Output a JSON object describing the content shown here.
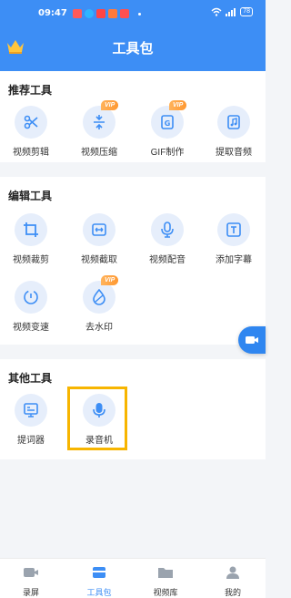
{
  "status_bar": {
    "time": "09:47",
    "battery": "78"
  },
  "header": {
    "title": "工具包"
  },
  "sections": {
    "recommended": {
      "title": "推荐工具",
      "tools": [
        {
          "label": "视频剪辑",
          "icon": "scissors-icon"
        },
        {
          "label": "视频压缩",
          "icon": "compress-icon",
          "badge": "VIP"
        },
        {
          "label": "GIF制作",
          "icon": "gif-icon",
          "badge": "VIP"
        },
        {
          "label": "提取音频",
          "icon": "music-icon"
        }
      ]
    },
    "edit": {
      "title": "编辑工具",
      "tools": [
        {
          "label": "视频裁剪",
          "icon": "crop-icon"
        },
        {
          "label": "视频截取",
          "icon": "trim-icon"
        },
        {
          "label": "视频配音",
          "icon": "microphone-icon"
        },
        {
          "label": "添加字幕",
          "icon": "text-icon"
        },
        {
          "label": "视频变速",
          "icon": "speed-icon"
        },
        {
          "label": "去水印",
          "icon": "droplet-icon",
          "badge": "VIP"
        }
      ]
    },
    "other": {
      "title": "其他工具",
      "tools": [
        {
          "label": "提词器",
          "icon": "teleprompter-icon"
        },
        {
          "label": "录音机",
          "icon": "microphone-icon"
        }
      ]
    }
  },
  "bottom_nav": {
    "items": [
      {
        "label": "录屏",
        "icon": "record-icon"
      },
      {
        "label": "工具包",
        "icon": "toolbox-icon",
        "active": true
      },
      {
        "label": "视频库",
        "icon": "folder-icon"
      },
      {
        "label": "我的",
        "icon": "user-icon"
      }
    ]
  },
  "colors": {
    "accent": "#3d8ef5",
    "highlight": "#f7b500",
    "vip": "#ff9830"
  }
}
